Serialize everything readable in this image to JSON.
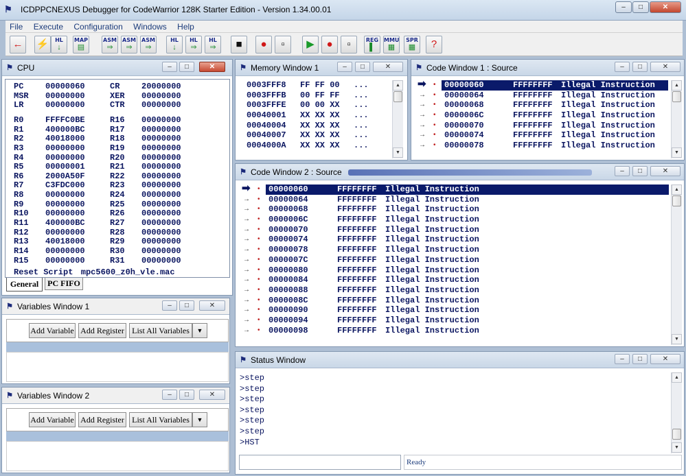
{
  "app": {
    "title": "ICDPPCNEXUS Debugger for CodeWarrior 128K Starter Edition - Version 1.34.00.01",
    "icon": "debugger-icon"
  },
  "window_controls": {
    "minimize": "–",
    "maximize": "□",
    "close": "✕"
  },
  "menu": [
    "File",
    "Execute",
    "Configuration",
    "Windows",
    "Help"
  ],
  "toolbar": [
    {
      "name": "back-arrow-button",
      "label": "",
      "glyph": "←"
    },
    {
      "name": "reset-button",
      "label": "",
      "glyph": "⚡"
    },
    {
      "name": "hl-load-button",
      "label": "HL",
      "glyph": "↓"
    },
    {
      "name": "map-button",
      "label": "MAP",
      "glyph": "▤"
    },
    {
      "name": "asm-step-button",
      "label": "ASM",
      "glyph": "⇒"
    },
    {
      "name": "asm-step-over-button",
      "label": "ASM",
      "glyph": "⇒"
    },
    {
      "name": "asm-run-button",
      "label": "ASM",
      "glyph": "⇒"
    },
    {
      "name": "hl-source-step-button",
      "label": "HL",
      "glyph": "↓"
    },
    {
      "name": "hl-source-step-over-button",
      "label": "HL",
      "glyph": "⇒"
    },
    {
      "name": "hl-source-run-button",
      "label": "HL",
      "glyph": "⇒"
    },
    {
      "name": "stop-button",
      "label": "",
      "glyph": "■"
    },
    {
      "name": "breakpoint-button",
      "label": "",
      "glyph": "●"
    },
    {
      "name": "clear-breakpoint-button",
      "label": "",
      "glyph": "▫"
    },
    {
      "name": "run-button",
      "label": "",
      "glyph": "▶"
    },
    {
      "name": "run-to-breakpoint-button",
      "label": "",
      "glyph": "●"
    },
    {
      "name": "trace-button",
      "label": "",
      "glyph": "▫"
    },
    {
      "name": "reg-button",
      "label": "REG",
      "glyph": "▌"
    },
    {
      "name": "mmu-button",
      "label": "MMU",
      "glyph": "▦"
    },
    {
      "name": "spr-button",
      "label": "SPR",
      "glyph": "▦"
    },
    {
      "name": "help-button",
      "label": "",
      "glyph": "?"
    }
  ],
  "cpu": {
    "title": "CPU",
    "special_regs": [
      [
        "PC",
        "00000060",
        "CR",
        "20000000"
      ],
      [
        "MSR",
        "00000000",
        "XER",
        "00000000"
      ],
      [
        "LR",
        "00000000",
        "CTR",
        "00000000"
      ]
    ],
    "gprs": [
      [
        "R0",
        "FFFFC0BE",
        "R16",
        "00000000"
      ],
      [
        "R1",
        "400000BC",
        "R17",
        "00000000"
      ],
      [
        "R2",
        "40018000",
        "R18",
        "00000000"
      ],
      [
        "R3",
        "00000000",
        "R19",
        "00000000"
      ],
      [
        "R4",
        "00000000",
        "R20",
        "00000000"
      ],
      [
        "R5",
        "00000001",
        "R21",
        "00000000"
      ],
      [
        "R6",
        "2000A50F",
        "R22",
        "00000000"
      ],
      [
        "R7",
        "C3FDC000",
        "R23",
        "00000000"
      ],
      [
        "R8",
        "00000000",
        "R24",
        "00000000"
      ],
      [
        "R9",
        "00000000",
        "R25",
        "00000000"
      ],
      [
        "R10",
        "00000000",
        "R26",
        "00000000"
      ],
      [
        "R11",
        "400000BC",
        "R27",
        "00000000"
      ],
      [
        "R12",
        "00000000",
        "R28",
        "00000000"
      ],
      [
        "R13",
        "40018000",
        "R29",
        "00000000"
      ],
      [
        "R14",
        "00000000",
        "R30",
        "00000000"
      ],
      [
        "R15",
        "00000000",
        "R31",
        "00000000"
      ]
    ],
    "reset_script_label": "Reset Script",
    "reset_script": "mpc5600_z0h_vle.mac",
    "tabs": [
      "General",
      "PC FIFO"
    ]
  },
  "memory": {
    "title": "Memory Window 1",
    "rows": [
      [
        "0003FFF8",
        "FF FF 00",
        "..."
      ],
      [
        "0003FFFB",
        "00 FF FF",
        "..."
      ],
      [
        "0003FFFE",
        "00 00 XX",
        "..."
      ],
      [
        "00040001",
        "XX XX XX",
        "..."
      ],
      [
        "00040004",
        "XX XX XX",
        "..."
      ],
      [
        "00040007",
        "XX XX XX",
        "..."
      ],
      [
        "0004000A",
        "XX XX XX",
        "..."
      ]
    ]
  },
  "code1": {
    "title": "Code Window 1 : Source",
    "rows": [
      [
        "00000060",
        "FFFFFFFF",
        "Illegal Instruction"
      ],
      [
        "00000064",
        "FFFFFFFF",
        "Illegal Instruction"
      ],
      [
        "00000068",
        "FFFFFFFF",
        "Illegal Instruction"
      ],
      [
        "0000006C",
        "FFFFFFFF",
        "Illegal Instruction"
      ],
      [
        "00000070",
        "FFFFFFFF",
        "Illegal Instruction"
      ],
      [
        "00000074",
        "FFFFFFFF",
        "Illegal Instruction"
      ],
      [
        "00000078",
        "FFFFFFFF",
        "Illegal Instruction"
      ]
    ]
  },
  "code2": {
    "title": "Code Window 2 : Source",
    "rows": [
      [
        "00000060",
        "FFFFFFFF",
        "Illegal Instruction"
      ],
      [
        "00000064",
        "FFFFFFFF",
        "Illegal Instruction"
      ],
      [
        "00000068",
        "FFFFFFFF",
        "Illegal Instruction"
      ],
      [
        "0000006C",
        "FFFFFFFF",
        "Illegal Instruction"
      ],
      [
        "00000070",
        "FFFFFFFF",
        "Illegal Instruction"
      ],
      [
        "00000074",
        "FFFFFFFF",
        "Illegal Instruction"
      ],
      [
        "00000078",
        "FFFFFFFF",
        "Illegal Instruction"
      ],
      [
        "0000007C",
        "FFFFFFFF",
        "Illegal Instruction"
      ],
      [
        "00000080",
        "FFFFFFFF",
        "Illegal Instruction"
      ],
      [
        "00000084",
        "FFFFFFFF",
        "Illegal Instruction"
      ],
      [
        "00000088",
        "FFFFFFFF",
        "Illegal Instruction"
      ],
      [
        "0000008C",
        "FFFFFFFF",
        "Illegal Instruction"
      ],
      [
        "00000090",
        "FFFFFFFF",
        "Illegal Instruction"
      ],
      [
        "00000094",
        "FFFFFFFF",
        "Illegal Instruction"
      ],
      [
        "00000098",
        "FFFFFFFF",
        "Illegal Instruction"
      ]
    ]
  },
  "variables1": {
    "title": "Variables Window 1",
    "add_variable": "Add Variable",
    "add_register": "Add Register",
    "list_all": "List All Variables"
  },
  "variables2": {
    "title": "Variables Window 2",
    "add_variable": "Add Variable",
    "add_register": "Add Register",
    "list_all": "List All Variables"
  },
  "status": {
    "title": "Status Window",
    "lines": [
      ">step",
      ">step",
      ">step",
      ">step",
      ">step",
      ">step",
      ">HST"
    ],
    "command_input": "",
    "state": "Ready"
  },
  "colors": {
    "selection": "#0a1a6a",
    "accent": "#1a3a7a",
    "mdi_background": "#aebfd4"
  }
}
